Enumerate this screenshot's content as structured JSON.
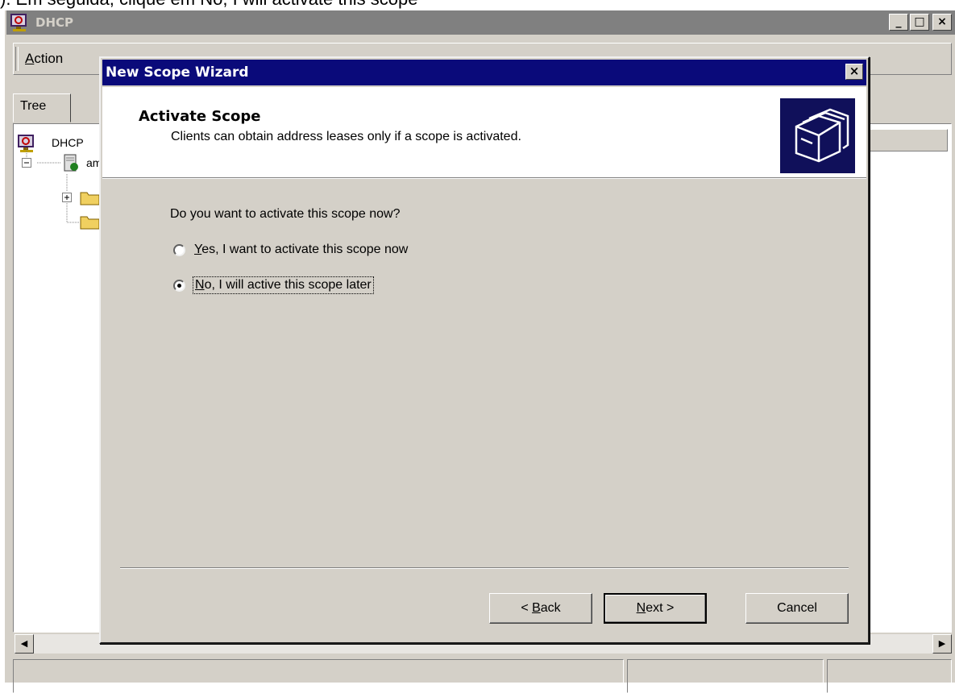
{
  "caption": "). Em seguida, clique em No, I will activate this scope",
  "main_window": {
    "title": "DHCP",
    "menu": {
      "action": "Action",
      "action_mnemonic": "A",
      "action_rest": "ction"
    },
    "tab": "Tree",
    "tree": {
      "root": "DHCP",
      "child": "am"
    },
    "controls": {
      "minimize": "_",
      "maximize": "□",
      "close": "×"
    }
  },
  "wizard": {
    "title": "New Scope Wizard",
    "close": "×",
    "header": {
      "title": "Activate Scope",
      "subtitle": "Clients can obtain address leases only if a scope is activated."
    },
    "question": "Do you want to activate this scope now?",
    "options": [
      {
        "mnemonic": "Y",
        "rest": "es, I want to activate this scope now",
        "selected": false
      },
      {
        "mnemonic": "N",
        "rest": "o, I will active this scope later",
        "selected": true
      }
    ],
    "buttons": {
      "back_prefix": "< ",
      "back_mnemonic": "B",
      "back_rest": "ack",
      "next_mnemonic": "N",
      "next_rest": "ext >",
      "cancel": "Cancel"
    }
  },
  "colors": {
    "wizard_titlebar": "#0a0a7a",
    "inactive_titlebar": "#808080",
    "face": "#d4d0c8",
    "header_icon_bg": "#10105a"
  }
}
